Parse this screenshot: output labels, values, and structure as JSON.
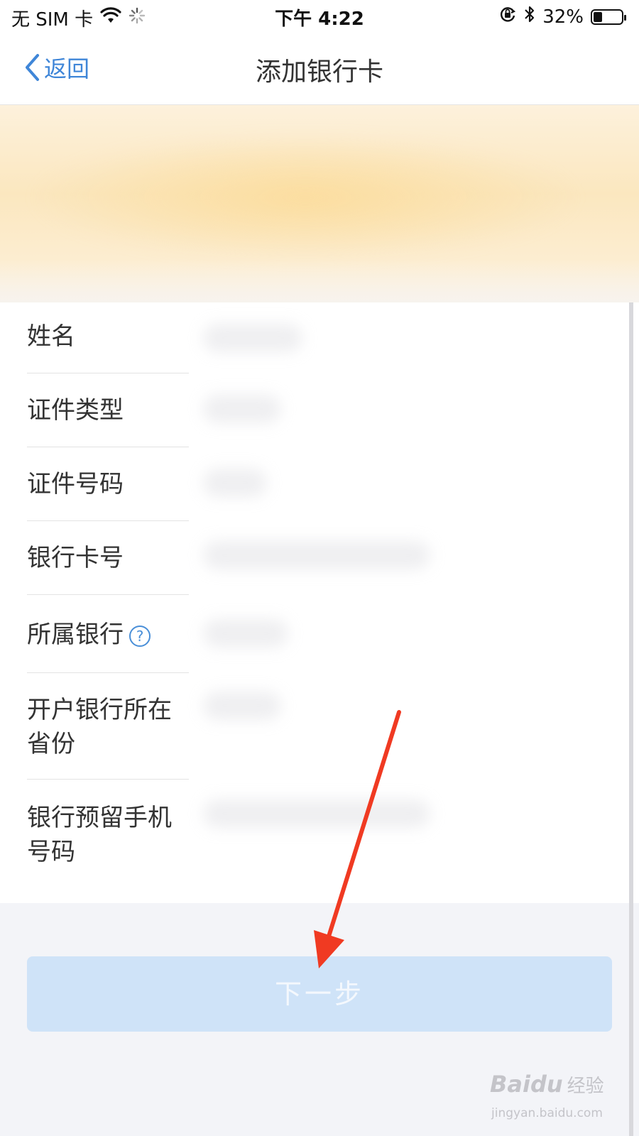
{
  "status_bar": {
    "carrier": "无 SIM 卡",
    "time": "下午 4:22",
    "battery": "32%",
    "battery_level": 0.32
  },
  "nav": {
    "back_label": "返回",
    "title": "添加银行卡"
  },
  "form": {
    "fields": [
      {
        "label": "姓名"
      },
      {
        "label": "证件类型"
      },
      {
        "label": "证件号码"
      },
      {
        "label": "银行卡号"
      },
      {
        "label": "所属银行",
        "help_icon": "?"
      },
      {
        "label": "开户银行所在省份"
      },
      {
        "label": "银行预留手机号码"
      }
    ]
  },
  "next_button": {
    "label": "下一步"
  },
  "colors": {
    "accent": "#3f86d8",
    "button_disabled": "#cfe3f8",
    "arrow": "#f03a22"
  },
  "watermark": {
    "brand": "Baidu",
    "brand_cn": "经验",
    "url": "jingyan.baidu.com"
  }
}
